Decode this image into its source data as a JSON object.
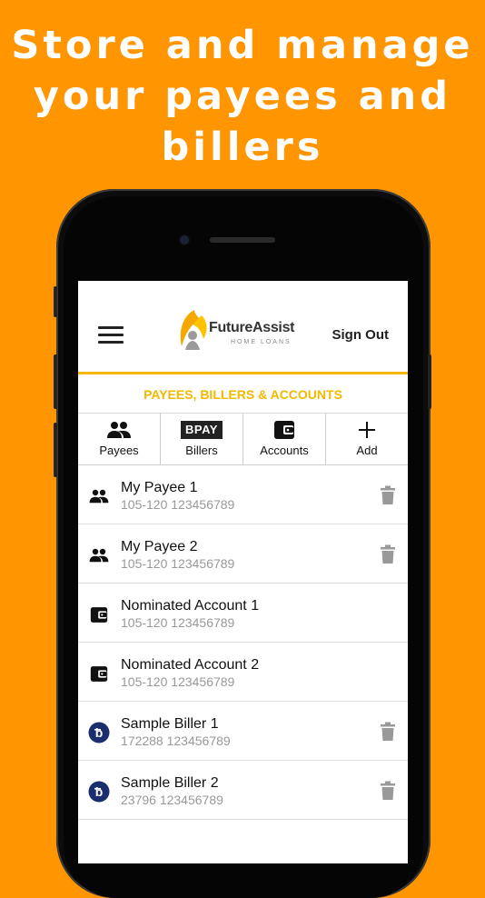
{
  "headline": {
    "line1": "Store and manage",
    "line2": "your payees and",
    "line3": "billers"
  },
  "app": {
    "logo_text": "FutureAssist",
    "logo_sub": "HOME LOANS",
    "sign_out": "Sign Out",
    "section_title": "PAYEES, BILLERS & ACCOUNTS",
    "accent": "#F5B800",
    "tabs": [
      {
        "label": "Payees",
        "icon": "people-icon"
      },
      {
        "label": "Billers",
        "icon": "bpay-icon",
        "icon_text": "BPAY"
      },
      {
        "label": "Accounts",
        "icon": "wallet-icon"
      },
      {
        "label": "Add",
        "icon": "plus-icon"
      }
    ],
    "items": [
      {
        "name": "My Payee 1",
        "detail": "105-120 123456789",
        "type": "payee",
        "deletable": true
      },
      {
        "name": "My Payee 2",
        "detail": "105-120 123456789",
        "type": "payee",
        "deletable": true
      },
      {
        "name": "Nominated Account 1",
        "detail": "105-120 123456789",
        "type": "account",
        "deletable": false
      },
      {
        "name": "Nominated Account 2",
        "detail": "105-120 123456789",
        "type": "account",
        "deletable": false
      },
      {
        "name": "Sample Biller 1",
        "detail": "172288 123456789",
        "type": "biller",
        "deletable": true
      },
      {
        "name": "Sample Biller 2",
        "detail": "23796 123456789",
        "type": "biller",
        "deletable": true
      }
    ]
  },
  "colors": {
    "background": "#FF9500",
    "biller_badge": "#1a2e6e"
  }
}
